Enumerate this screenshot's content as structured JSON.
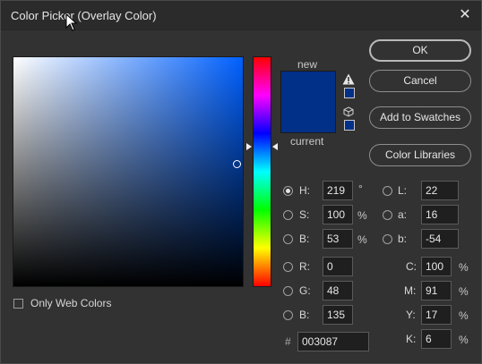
{
  "dialog": {
    "title": "Color Picker (Overlay Color)",
    "close_glyph": "✕"
  },
  "colors": {
    "new_color": "#003087",
    "current_color": "#003087"
  },
  "preview": {
    "new_label": "new",
    "current_label": "current"
  },
  "buttons": {
    "ok": "OK",
    "cancel": "Cancel",
    "add_to_swatches": "Add to Swatches",
    "color_libraries": "Color Libraries"
  },
  "hsb": {
    "h": {
      "label": "H:",
      "value": "219",
      "unit": "°",
      "selected": true
    },
    "s": {
      "label": "S:",
      "value": "100",
      "unit": "%",
      "selected": false
    },
    "b": {
      "label": "B:",
      "value": "53",
      "unit": "%",
      "selected": false
    }
  },
  "lab": {
    "l": {
      "label": "L:",
      "value": "22",
      "selected": false
    },
    "a": {
      "label": "a:",
      "value": "16",
      "selected": false
    },
    "b": {
      "label": "b:",
      "value": "-54",
      "selected": false
    }
  },
  "rgb": {
    "r": {
      "label": "R:",
      "value": "0",
      "selected": false
    },
    "g": {
      "label": "G:",
      "value": "48",
      "selected": false
    },
    "b": {
      "label": "B:",
      "value": "135",
      "selected": false
    }
  },
  "cmyk": {
    "c": {
      "label": "C:",
      "value": "100",
      "unit": "%"
    },
    "m": {
      "label": "M:",
      "value": "91",
      "unit": "%"
    },
    "y": {
      "label": "Y:",
      "value": "17",
      "unit": "%"
    },
    "k": {
      "label": "K:",
      "value": "6",
      "unit": "%"
    }
  },
  "hex": {
    "label": "#",
    "value": "003087"
  },
  "options": {
    "only_web_colors": "Only Web Colors",
    "only_web_colors_checked": false
  }
}
